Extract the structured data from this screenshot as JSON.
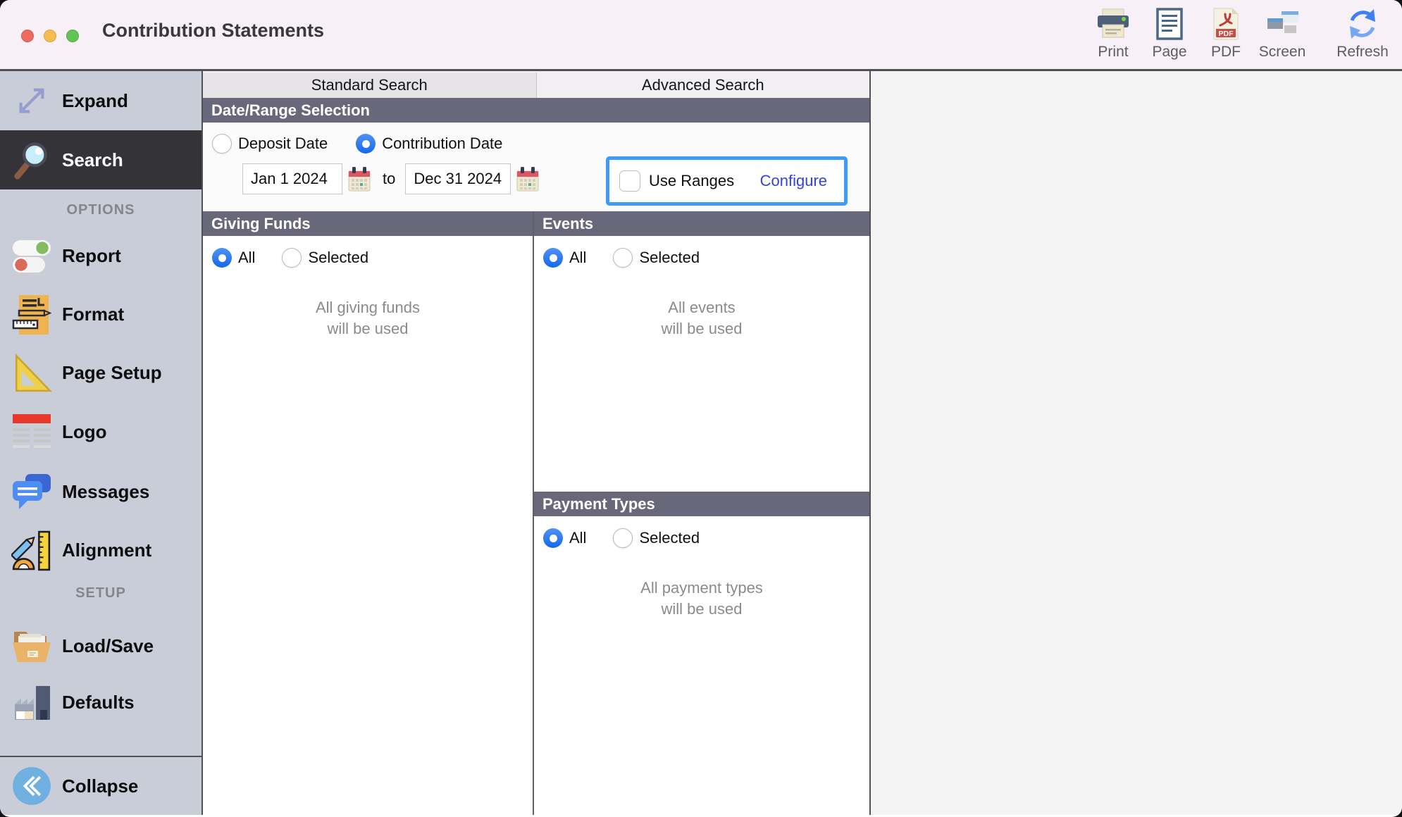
{
  "window": {
    "title": "Contribution Statements",
    "traffic_lights": [
      "close",
      "minimize",
      "zoom"
    ]
  },
  "toolbar": {
    "items": [
      {
        "label": "Print",
        "icon": "printer-icon"
      },
      {
        "label": "Page",
        "icon": "page-icon"
      },
      {
        "label": "PDF",
        "icon": "pdf-icon"
      },
      {
        "label": "Screen",
        "icon": "screen-windows-icon"
      },
      {
        "label": "Refresh",
        "icon": "refresh-icon"
      }
    ]
  },
  "sidebar": {
    "expand": {
      "label": "Expand",
      "icon": "expand-arrows-icon"
    },
    "search": {
      "label": "Search",
      "icon": "magnifier-icon",
      "selected": true
    },
    "options_header": "OPTIONS",
    "options_items": [
      {
        "label": "Report",
        "icon": "toggles-icon"
      },
      {
        "label": "Format",
        "icon": "format-document-icon"
      },
      {
        "label": "Page Setup",
        "icon": "set-square-icon"
      },
      {
        "label": "Logo",
        "icon": "logo-layout-icon"
      },
      {
        "label": "Messages",
        "icon": "chat-bubbles-icon"
      },
      {
        "label": "Alignment",
        "icon": "ruler-pencil-protractor-icon"
      }
    ],
    "setup_header": "SETUP",
    "setup_items": [
      {
        "label": "Load/Save",
        "icon": "open-folder-icon"
      },
      {
        "label": "Defaults",
        "icon": "factory-icon"
      }
    ],
    "collapse": {
      "label": "Collapse",
      "icon": "collapse-chevrons-icon"
    }
  },
  "tabs": {
    "standard": "Standard Search",
    "advanced": "Advanced Search",
    "active": "Standard Search"
  },
  "search_panel": {
    "date_range": {
      "header": "Date/Range Selection",
      "deposit_label": "Deposit Date",
      "contribution_label": "Contribution Date",
      "selected_radio": "Contribution Date",
      "from_value": "Jan 1 2024",
      "to_label": "to",
      "to_value": "Dec 31 2024",
      "use_ranges_label": "Use Ranges",
      "use_ranges_checked": false,
      "configure_label": "Configure"
    },
    "giving_funds": {
      "header": "Giving Funds",
      "all_label": "All",
      "selected_label": "Selected",
      "choice": "All",
      "note_line1": "All giving funds",
      "note_line2": "will be used"
    },
    "events": {
      "header": "Events",
      "all_label": "All",
      "selected_label": "Selected",
      "choice": "All",
      "note_line1": "All events",
      "note_line2": "will be used"
    },
    "payment_types": {
      "header": "Payment Types",
      "all_label": "All",
      "selected_label": "Selected",
      "choice": "All",
      "note_line1": "All payment types",
      "note_line2": "will be used"
    }
  },
  "colors": {
    "titlebar_bg": "#f7f0f6",
    "sidebar_bg": "#c9cdd8",
    "selected_row_bg": "#333338",
    "section_header_bg": "#68687a",
    "accent_radio_blue": "#1d72f2",
    "focus_ring_blue": "#3f9bf5",
    "link_blue": "#3642df",
    "right_panel_bg": "#f5f4f5",
    "traffic_red": "#ee6a5f",
    "traffic_yellow": "#f5bd4f",
    "traffic_green": "#61c454"
  }
}
